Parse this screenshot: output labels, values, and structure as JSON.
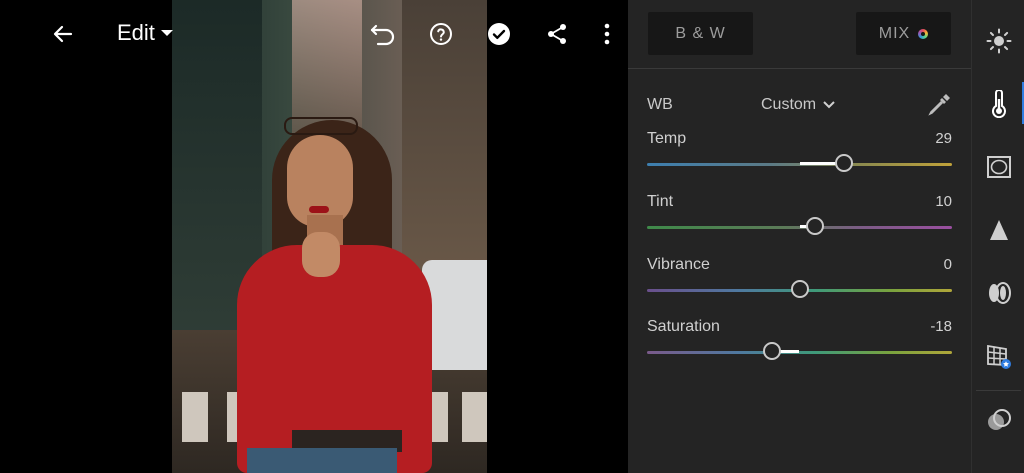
{
  "topbar": {
    "title": "Edit",
    "icons": [
      "back-arrow-icon",
      "undo-icon",
      "help-icon",
      "done-check-icon",
      "share-icon",
      "more-vert-icon"
    ]
  },
  "panel": {
    "tabs": {
      "bw_label": "B & W",
      "mix_label": "MIX"
    },
    "wb": {
      "label": "WB",
      "value": "Custom"
    },
    "sliders": [
      {
        "label": "Temp",
        "value": "29",
        "level": 0.645
      },
      {
        "label": "Tint",
        "value": "10",
        "level": 0.55
      },
      {
        "label": "Vibrance",
        "value": "0",
        "level": 0.5
      },
      {
        "label": "Saturation",
        "value": "-18",
        "level": 0.41
      }
    ]
  },
  "sidebar": {
    "items": [
      "light-icon",
      "color-thermometer-icon",
      "effects-vignette-icon",
      "detail-sharpen-icon",
      "optics-lens-icon",
      "geometry-grid-icon",
      "presets-overlay-icon"
    ],
    "active": "color-thermometer-icon"
  },
  "colors": {
    "accent": "#2f7de1",
    "panel_bg": "#242424",
    "pill_bg": "#171717"
  }
}
